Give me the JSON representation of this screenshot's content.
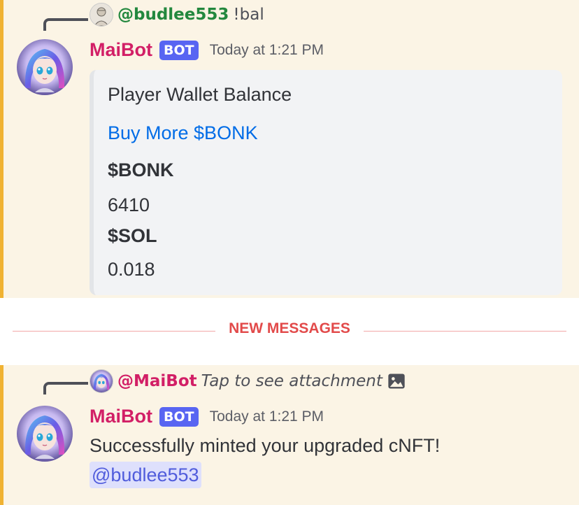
{
  "message_1": {
    "reply": {
      "user": "@budlee553",
      "content": "!bal"
    },
    "author": "MaiBot",
    "tag": "BOT",
    "timestamp": "Today at 1:21 PM",
    "embed": {
      "title": "Player Wallet Balance",
      "link": "Buy More $BONK",
      "fields": [
        {
          "name": "$BONK",
          "value": "6410"
        },
        {
          "name": "$SOL",
          "value": "0.018"
        }
      ]
    }
  },
  "divider": {
    "label": "NEW MESSAGES"
  },
  "message_2": {
    "reply": {
      "user": "@MaiBot",
      "content": "Tap to see attachment"
    },
    "author": "MaiBot",
    "tag": "BOT",
    "timestamp": "Today at 1:21 PM",
    "content": "Successfully minted your upgraded cNFT!",
    "mention": "@budlee553"
  },
  "colors": {
    "mention_highlight_bg": "#fbf4e5",
    "mention_bar": "#f0b232",
    "bot_name": "#d21f66",
    "bot_tag": "#5865f2",
    "link": "#006ce7",
    "new_messages": "#e24a4a",
    "user_green": "#23883e"
  },
  "icons": {
    "reply_avatar_1": "user-avatar-icon",
    "bot_avatar": "anime-girl-avatar",
    "attachment": "image-icon"
  }
}
